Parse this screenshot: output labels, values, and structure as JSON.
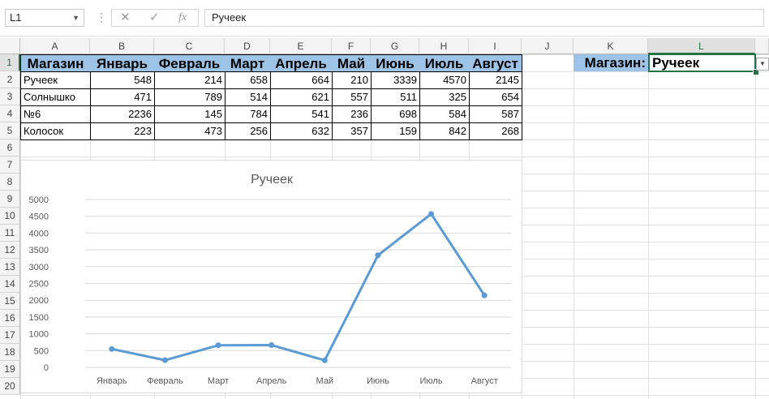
{
  "formula_bar": {
    "name_box": "L1",
    "formula": "Ручеек",
    "fx_label": "fx",
    "cancel_glyph": "✕",
    "enter_glyph": "✓"
  },
  "columns": [
    "A",
    "B",
    "C",
    "D",
    "E",
    "F",
    "G",
    "H",
    "I",
    "J",
    "K",
    "L"
  ],
  "rows": [
    "1",
    "2",
    "3",
    "4",
    "5",
    "6",
    "7",
    "8",
    "9",
    "10",
    "11",
    "12",
    "13",
    "14",
    "15",
    "16",
    "17",
    "18",
    "19",
    "20"
  ],
  "table": {
    "headers": [
      "Магазин",
      "Январь",
      "Февраль",
      "Март",
      "Апрель",
      "Май",
      "Июнь",
      "Июль",
      "Август"
    ],
    "data": [
      [
        "Ручеек",
        "548",
        "214",
        "658",
        "664",
        "210",
        "3339",
        "4570",
        "2145"
      ],
      [
        "Солнышко",
        "471",
        "789",
        "514",
        "621",
        "557",
        "511",
        "325",
        "654"
      ],
      [
        "№6",
        "2236",
        "145",
        "784",
        "541",
        "236",
        "698",
        "584",
        "587"
      ],
      [
        "Колосок",
        "223",
        "473",
        "256",
        "632",
        "357",
        "159",
        "842",
        "268"
      ]
    ]
  },
  "selector": {
    "label": "Магазин:",
    "value": "Ручеек"
  },
  "colors": {
    "header_fill": "#9dc3e6",
    "series": "#5b9bd5",
    "selection": "#217346"
  },
  "chart_data": {
    "type": "line",
    "title": "Ручеек",
    "categories": [
      "Январь",
      "Февраль",
      "Март",
      "Апрель",
      "Май",
      "Июнь",
      "Июль",
      "Август"
    ],
    "series": [
      {
        "values": [
          548,
          214,
          658,
          664,
          210,
          3339,
          4570,
          2145
        ]
      }
    ],
    "ylim": [
      0,
      5000
    ],
    "yticks": [
      0,
      500,
      1000,
      1500,
      2000,
      2500,
      3000,
      3500,
      4000,
      4500,
      5000
    ],
    "grid": true,
    "xlabel": "",
    "ylabel": ""
  }
}
